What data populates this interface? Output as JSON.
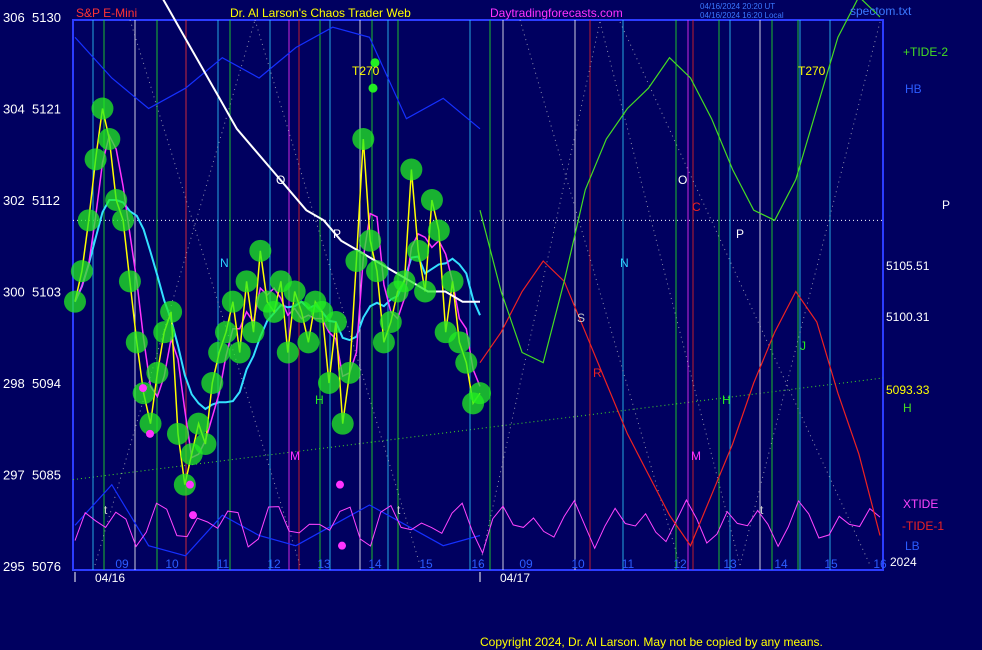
{
  "header": {
    "left_title": "S&P E-Mini",
    "center_title": "Dr. Al Larson's Chaos Trader Web",
    "site": "Daytradingforecasts.com",
    "update_line1": "04/16/2024 20:20 UT",
    "update_line2": "04/16/2024 16:20 Local",
    "file": "spectom.txt"
  },
  "colors": {
    "background": "#000060",
    "frame": "#2c3cff",
    "price": "#ffff00",
    "ema_fast": "#ff33ff",
    "ema_slow": "#33e0ff",
    "white_line": "#ffffff",
    "tide_plus": "#44dd22",
    "tide_minus": "#ee2222",
    "xtide": "#ff44ff",
    "band": "#1530ff",
    "dots": "#22ee22"
  },
  "chart_data": {
    "type": "line",
    "title": "S&P E-Mini",
    "y_left_ticks": [
      {
        "a": "306",
        "b": "5130",
        "value": 5130
      },
      {
        "a": "304",
        "b": "5121",
        "value": 5121
      },
      {
        "a": "302",
        "b": "5112",
        "value": 5112
      },
      {
        "a": "300",
        "b": "5103",
        "value": 5103
      },
      {
        "a": "298",
        "b": "5094",
        "value": 5094
      },
      {
        "a": "297",
        "b": "5085",
        "value": 5085
      },
      {
        "a": "295",
        "b": "5076",
        "value": 5076
      }
    ],
    "ylim": [
      5076,
      5130
    ],
    "x_hour_ticks": [
      "09",
      "10",
      "11",
      "12",
      "13",
      "14",
      "15",
      "16",
      "09",
      "10",
      "11",
      "12",
      "13",
      "14",
      "15",
      "16"
    ],
    "x_dates": [
      "04/16",
      "04/17"
    ],
    "year": "2024",
    "right_levels": [
      {
        "label": "5105.51",
        "value": 5105.51
      },
      {
        "label": "5100.31",
        "value": 5100.31
      },
      {
        "label": "5093.33",
        "value": 5093.33
      }
    ],
    "legend": [
      "+TIDE-2",
      "HB",
      "P",
      "H",
      "XTIDE",
      "-TIDE-1",
      "LB"
    ],
    "markers": [
      "T270",
      "T270"
    ],
    "event_letters": [
      "N",
      "O",
      "P",
      "H",
      "M",
      "S",
      "R",
      "J",
      "C",
      "t"
    ],
    "dotted_level": 5110,
    "price_series": [
      5102,
      5105,
      5110,
      5116,
      5121,
      5118,
      5112,
      5110,
      5104,
      5098,
      5093,
      5090,
      5095,
      5099,
      5101,
      5089,
      5084,
      5087,
      5090,
      5088,
      5094,
      5097,
      5099,
      5102,
      5097,
      5104,
      5099,
      5107,
      5102,
      5101,
      5104,
      5097,
      5103,
      5101,
      5098,
      5102,
      5101,
      5094,
      5100,
      5090,
      5095,
      5106,
      5118,
      5108,
      5105,
      5098,
      5100,
      5103,
      5104,
      5115,
      5107,
      5103,
      5112,
      5109,
      5099,
      5104,
      5098,
      5096,
      5092,
      5093
    ],
    "white_line": [
      5134,
      5131,
      5128,
      5125,
      5122,
      5119,
      5117,
      5115,
      5113,
      5111,
      5110,
      5108,
      5107,
      5106,
      5105,
      5104,
      5103,
      5103,
      5102,
      5102
    ],
    "tide_plus_projection": [
      5111,
      5103,
      5097,
      5096,
      5104,
      5113,
      5118,
      5121,
      5123,
      5126,
      5124,
      5120,
      5115,
      5111,
      5110,
      5114,
      5121,
      5128,
      5132,
      5130
    ],
    "tide_minus_projection": [
      5096,
      5099,
      5103,
      5106,
      5104,
      5099,
      5094,
      5089,
      5085,
      5081,
      5078,
      5083,
      5088,
      5094,
      5099,
      5103,
      5100,
      5093,
      5087,
      5079
    ]
  },
  "footer": {
    "copyright": "Copyright 2024, Dr. Al Larson. May not be copied by any means."
  }
}
